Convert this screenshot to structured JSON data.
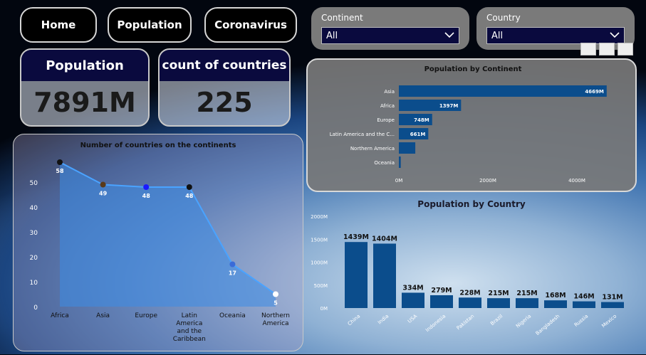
{
  "nav": {
    "home": "Home",
    "population": "Population",
    "coronavirus": "Coronavirus"
  },
  "filters": {
    "continent": {
      "label": "Continent",
      "value": "All"
    },
    "country": {
      "label": "Country",
      "value": "All"
    }
  },
  "kpis": {
    "population": {
      "title": "Population",
      "value": "7891M"
    },
    "countries": {
      "title": "count of countries",
      "value": "225"
    }
  },
  "chart_data": [
    {
      "type": "area",
      "title": "Number of countries on the continents",
      "categories": [
        "Africa",
        "Asia",
        "Europe",
        "Latin America and the Caribbean",
        "Oceania",
        "Northern America"
      ],
      "values": [
        58,
        49,
        48,
        48,
        17,
        5
      ],
      "yticks": [
        0,
        10,
        20,
        30,
        40,
        50
      ],
      "ylim": [
        0,
        60
      ]
    },
    {
      "type": "bar",
      "orientation": "horizontal",
      "title": "Population by Continent",
      "categories": [
        "Asia",
        "Africa",
        "Europe",
        "Latin America and the C...",
        "Northern America",
        "Oceania"
      ],
      "values": [
        4669,
        1397,
        748,
        661,
        369,
        43
      ],
      "labels": [
        "4669M",
        "1397M",
        "748M",
        "661M",
        "",
        ""
      ],
      "xticks": [
        "0M",
        "2000M",
        "4000M"
      ],
      "xlim": [
        0,
        5000
      ]
    },
    {
      "type": "bar",
      "title": "Population by Country",
      "categories": [
        "China",
        "India",
        "USA",
        "Indonesia",
        "Pakistan",
        "Brazil",
        "Nigeria",
        "Bangladesh",
        "Russia",
        "Mexico"
      ],
      "values": [
        1439,
        1404,
        334,
        279,
        228,
        215,
        215,
        168,
        146,
        131
      ],
      "labels": [
        "1439M",
        "1404M",
        "334M",
        "279M",
        "228M",
        "215M",
        "215M",
        "168M",
        "146M",
        "131M"
      ],
      "yticks": [
        "0M",
        "500M",
        "1000M",
        "1500M",
        "2000M"
      ],
      "ylim": [
        0,
        2000
      ]
    }
  ]
}
